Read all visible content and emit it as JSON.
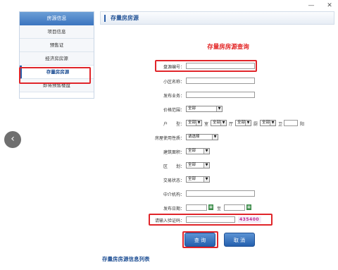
{
  "window": {
    "minimize": "—",
    "close": "✕"
  },
  "sidebar": {
    "header": "房源信息",
    "items": [
      "项目信息",
      "预售证",
      "经济房房源",
      "存量房房源",
      "即将预售楼盘"
    ],
    "active_index": 3
  },
  "main": {
    "title": "存量房房源"
  },
  "form": {
    "title": "存量房房源查询",
    "labels": {
      "code": "盘源编号：",
      "community": "小区名称：",
      "publisher": "发布业务：",
      "price": "价格范围：",
      "layout": "户　　型：",
      "usage": "房屋使用性质：",
      "area": "建筑面积：",
      "district": "区　　划：",
      "status": "交易状态：",
      "agency": "中介机构：",
      "date": "发布日期：",
      "captcha": "请输入验证码："
    },
    "selects": {
      "price": "全部",
      "room": "全部",
      "hall": "全部",
      "kitchen": "全部",
      "bath": "全部",
      "usage": "请选择",
      "area": "全部",
      "district": "全部",
      "status": "全部"
    },
    "layout_units": {
      "room": "室",
      "hall": "厅",
      "kitchen": "厨",
      "bath": "卫",
      "balcony": "阳"
    },
    "date_to": "至",
    "captcha_code": "435400",
    "query_button": "查 询",
    "cancel_button": "取 消"
  },
  "list_title": "存量房房源信息列表",
  "colors": {
    "accent": "#1e4f94",
    "highlight": "#e0252a",
    "title_red": "#e22222"
  }
}
